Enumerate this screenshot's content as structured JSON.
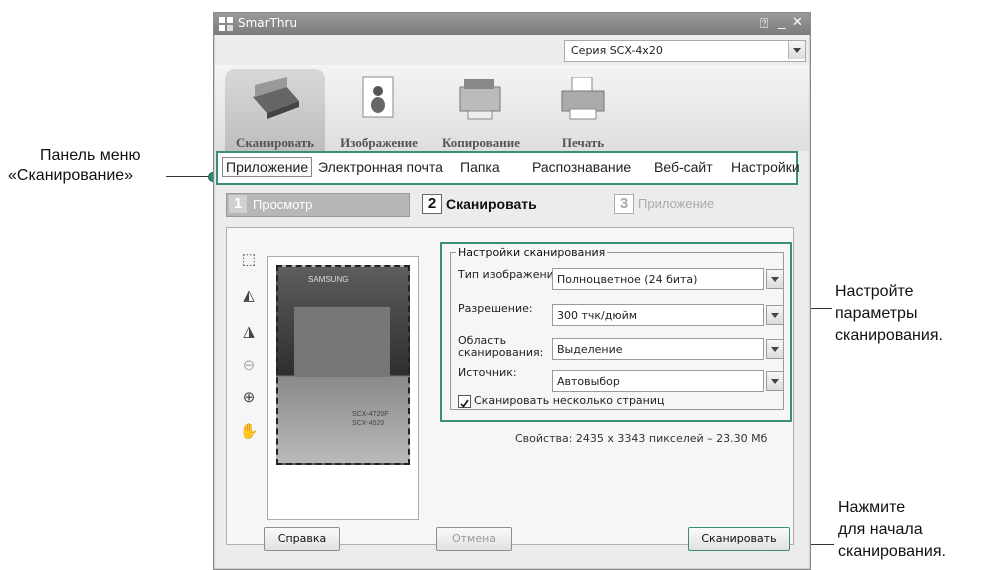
{
  "callouts": {
    "menu_panel_line1": "Панель меню",
    "menu_panel_line2": "«Сканирование»",
    "settings_line1": "Настройте",
    "settings_line2": "параметры",
    "settings_line3": "сканирования.",
    "scan_line1": "Нажмите",
    "scan_line2": "для начала",
    "scan_line3": "сканирования."
  },
  "window": {
    "title": "SmarThru",
    "series": "Серия SCX-4x20"
  },
  "toolbar": {
    "items": [
      {
        "label": "Сканировать"
      },
      {
        "label": "Изображение"
      },
      {
        "label": "Копирование"
      },
      {
        "label": "Печать"
      }
    ]
  },
  "menu": {
    "items": [
      {
        "label": "Приложение"
      },
      {
        "label": "Электронная почта"
      },
      {
        "label": "Папка"
      },
      {
        "label": "Распознавание"
      },
      {
        "label": "Веб-сайт"
      },
      {
        "label": "Настройки"
      }
    ]
  },
  "steps": [
    {
      "number": "1",
      "label": "Просмотр"
    },
    {
      "number": "2",
      "label": "Сканировать"
    },
    {
      "number": "3",
      "label": "Приложение"
    }
  ],
  "preview": {
    "model1": "SCX-4720F",
    "model2": "SCX-4520",
    "brand": "SAMSUNG"
  },
  "settings": {
    "group_title": "Настройки сканирования",
    "image_type_label": "Тип изображения:",
    "image_type_value": "Полноцветное (24 бита)",
    "resolution_label": "Разрешение:",
    "resolution_value": "300 тчк/дюйм",
    "area_label_1": "Область",
    "area_label_2": "сканирования:",
    "area_value": "Выделение",
    "source_label": "Источник:",
    "source_value": "Автовыбор",
    "multi_pages_label": "Сканировать несколько страниц",
    "properties": "Свойства: 2435 x 3343 пикселей – 23.30 Мб"
  },
  "buttons": {
    "help": "Справка",
    "cancel": "Отмена",
    "scan": "Сканировать"
  },
  "colors": {
    "accent": "#3c8c7a"
  }
}
